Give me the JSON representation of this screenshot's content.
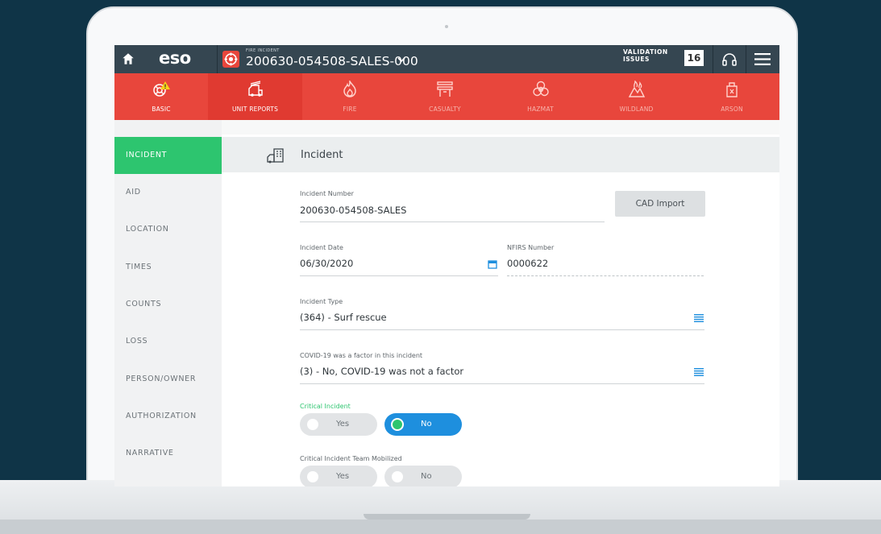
{
  "header": {
    "logo": "eso",
    "incident_kicker": "FIRE INCIDENT",
    "incident_title": "200630-054508-SALES-000",
    "validation_label_1": "VALIDATION",
    "validation_label_2": "ISSUES",
    "validation_count": "16"
  },
  "tabs": [
    {
      "label": "BASIC",
      "icon": "lifebuoy-warning-icon"
    },
    {
      "label": "UNIT REPORTS",
      "icon": "fire-truck-icon"
    },
    {
      "label": "FIRE",
      "icon": "flame-icon"
    },
    {
      "label": "CASUALTY",
      "icon": "stretcher-icon"
    },
    {
      "label": "HAZMAT",
      "icon": "biohazard-icon"
    },
    {
      "label": "WILDLAND",
      "icon": "wildland-fire-icon"
    },
    {
      "label": "ARSON",
      "icon": "fuel-can-icon"
    }
  ],
  "sidebar": {
    "items": [
      {
        "label": "INCIDENT"
      },
      {
        "label": "AID"
      },
      {
        "label": "LOCATION"
      },
      {
        "label": "TIMES"
      },
      {
        "label": "COUNTS"
      },
      {
        "label": "LOSS"
      },
      {
        "label": "PERSON/OWNER"
      },
      {
        "label": "AUTHORIZATION"
      },
      {
        "label": "NARRATIVE"
      }
    ]
  },
  "section": {
    "title": "Incident"
  },
  "form": {
    "incident_number_label": "Incident Number",
    "incident_number_value": "200630-054508-SALES",
    "cad_import_label": "CAD Import",
    "incident_date_label": "Incident Date",
    "incident_date_value": "06/30/2020",
    "nfirs_label": "NFIRS Number",
    "nfirs_value": "0000622",
    "incident_type_label": "Incident Type",
    "incident_type_value": "(364) - Surf rescue",
    "covid_label": "COVID-19 was a factor in this incident",
    "covid_value": "(3) - No, COVID-19 was not a factor",
    "critical_label": "Critical Incident",
    "critical_yes": "Yes",
    "critical_no": "No",
    "team_label": "Critical Incident Team Mobilized",
    "team_yes": "Yes",
    "team_no": "No"
  },
  "colors": {
    "background": "#0f3447",
    "topbar": "#354651",
    "tabbar": "#e8463c",
    "active_sidebar": "#2dc56f",
    "toggle_on": "#1e8fde",
    "critical_label": "#2dc56f"
  }
}
